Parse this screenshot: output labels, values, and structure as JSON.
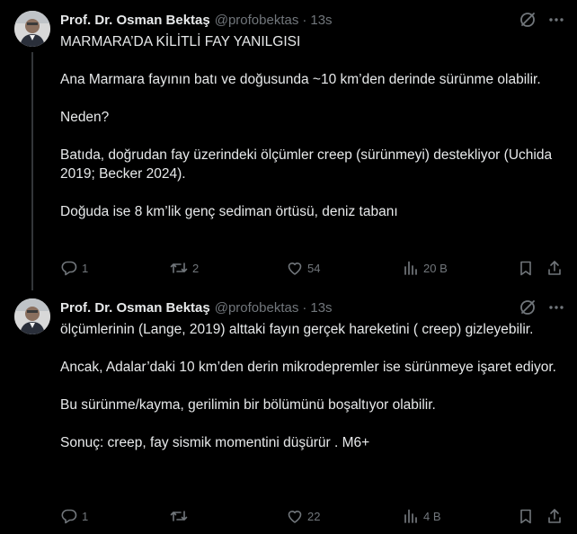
{
  "tweets": [
    {
      "author": {
        "name": "Prof. Dr. Osman Bektaş",
        "handle": "@profobektas"
      },
      "separator": "·",
      "time": "13s",
      "paragraphs": [
        "MARMARA’DA KİLİTLİ FAY YANILGISI",
        "Ana Marmara fayının batı ve doğusunda ~10 km’den derinde sürünme olabilir.",
        "Neden?",
        "Batıda, doğrudan fay üzerindeki ölçümler creep (sürünmeyi) destekliyor (Uchida 2019; Becker 2024).",
        "Doğuda ise 8 km’lik genç sediman örtüsü, deniz tabanı"
      ],
      "stats": {
        "replies": "1",
        "retweets": "2",
        "likes": "54",
        "views": "20 B"
      }
    },
    {
      "author": {
        "name": "Prof. Dr. Osman Bektaş",
        "handle": "@profobektas"
      },
      "separator": "·",
      "time": "13s",
      "paragraphs": [
        "ölçümlerinin (Lange, 2019) alttaki fayın gerçek hareketini ( creep) gizleyebilir.",
        "Ancak, Adalar’daki 10 km’den derin mikrodepremler ise sürünmeye işaret ediyor.",
        "Bu sürünme/kayma, gerilimin bir bölümünü  boşaltıyor olabilir.",
        "Sonuç: creep, fay sismik momentini düşürür . M6+"
      ],
      "stats": {
        "replies": "1",
        "retweets": "",
        "likes": "22",
        "views": "4 B"
      }
    }
  ],
  "icons": {
    "grok": "grok-icon",
    "more": "more-icon",
    "reply": "reply-icon",
    "retweet": "retweet-icon",
    "like": "heart-icon",
    "views": "views-icon",
    "bookmark": "bookmark-icon",
    "share": "share-icon"
  },
  "colors": {
    "background": "#000000",
    "text_primary": "#e7e9ea",
    "text_secondary": "#71767b",
    "thread_line": "#333639"
  }
}
